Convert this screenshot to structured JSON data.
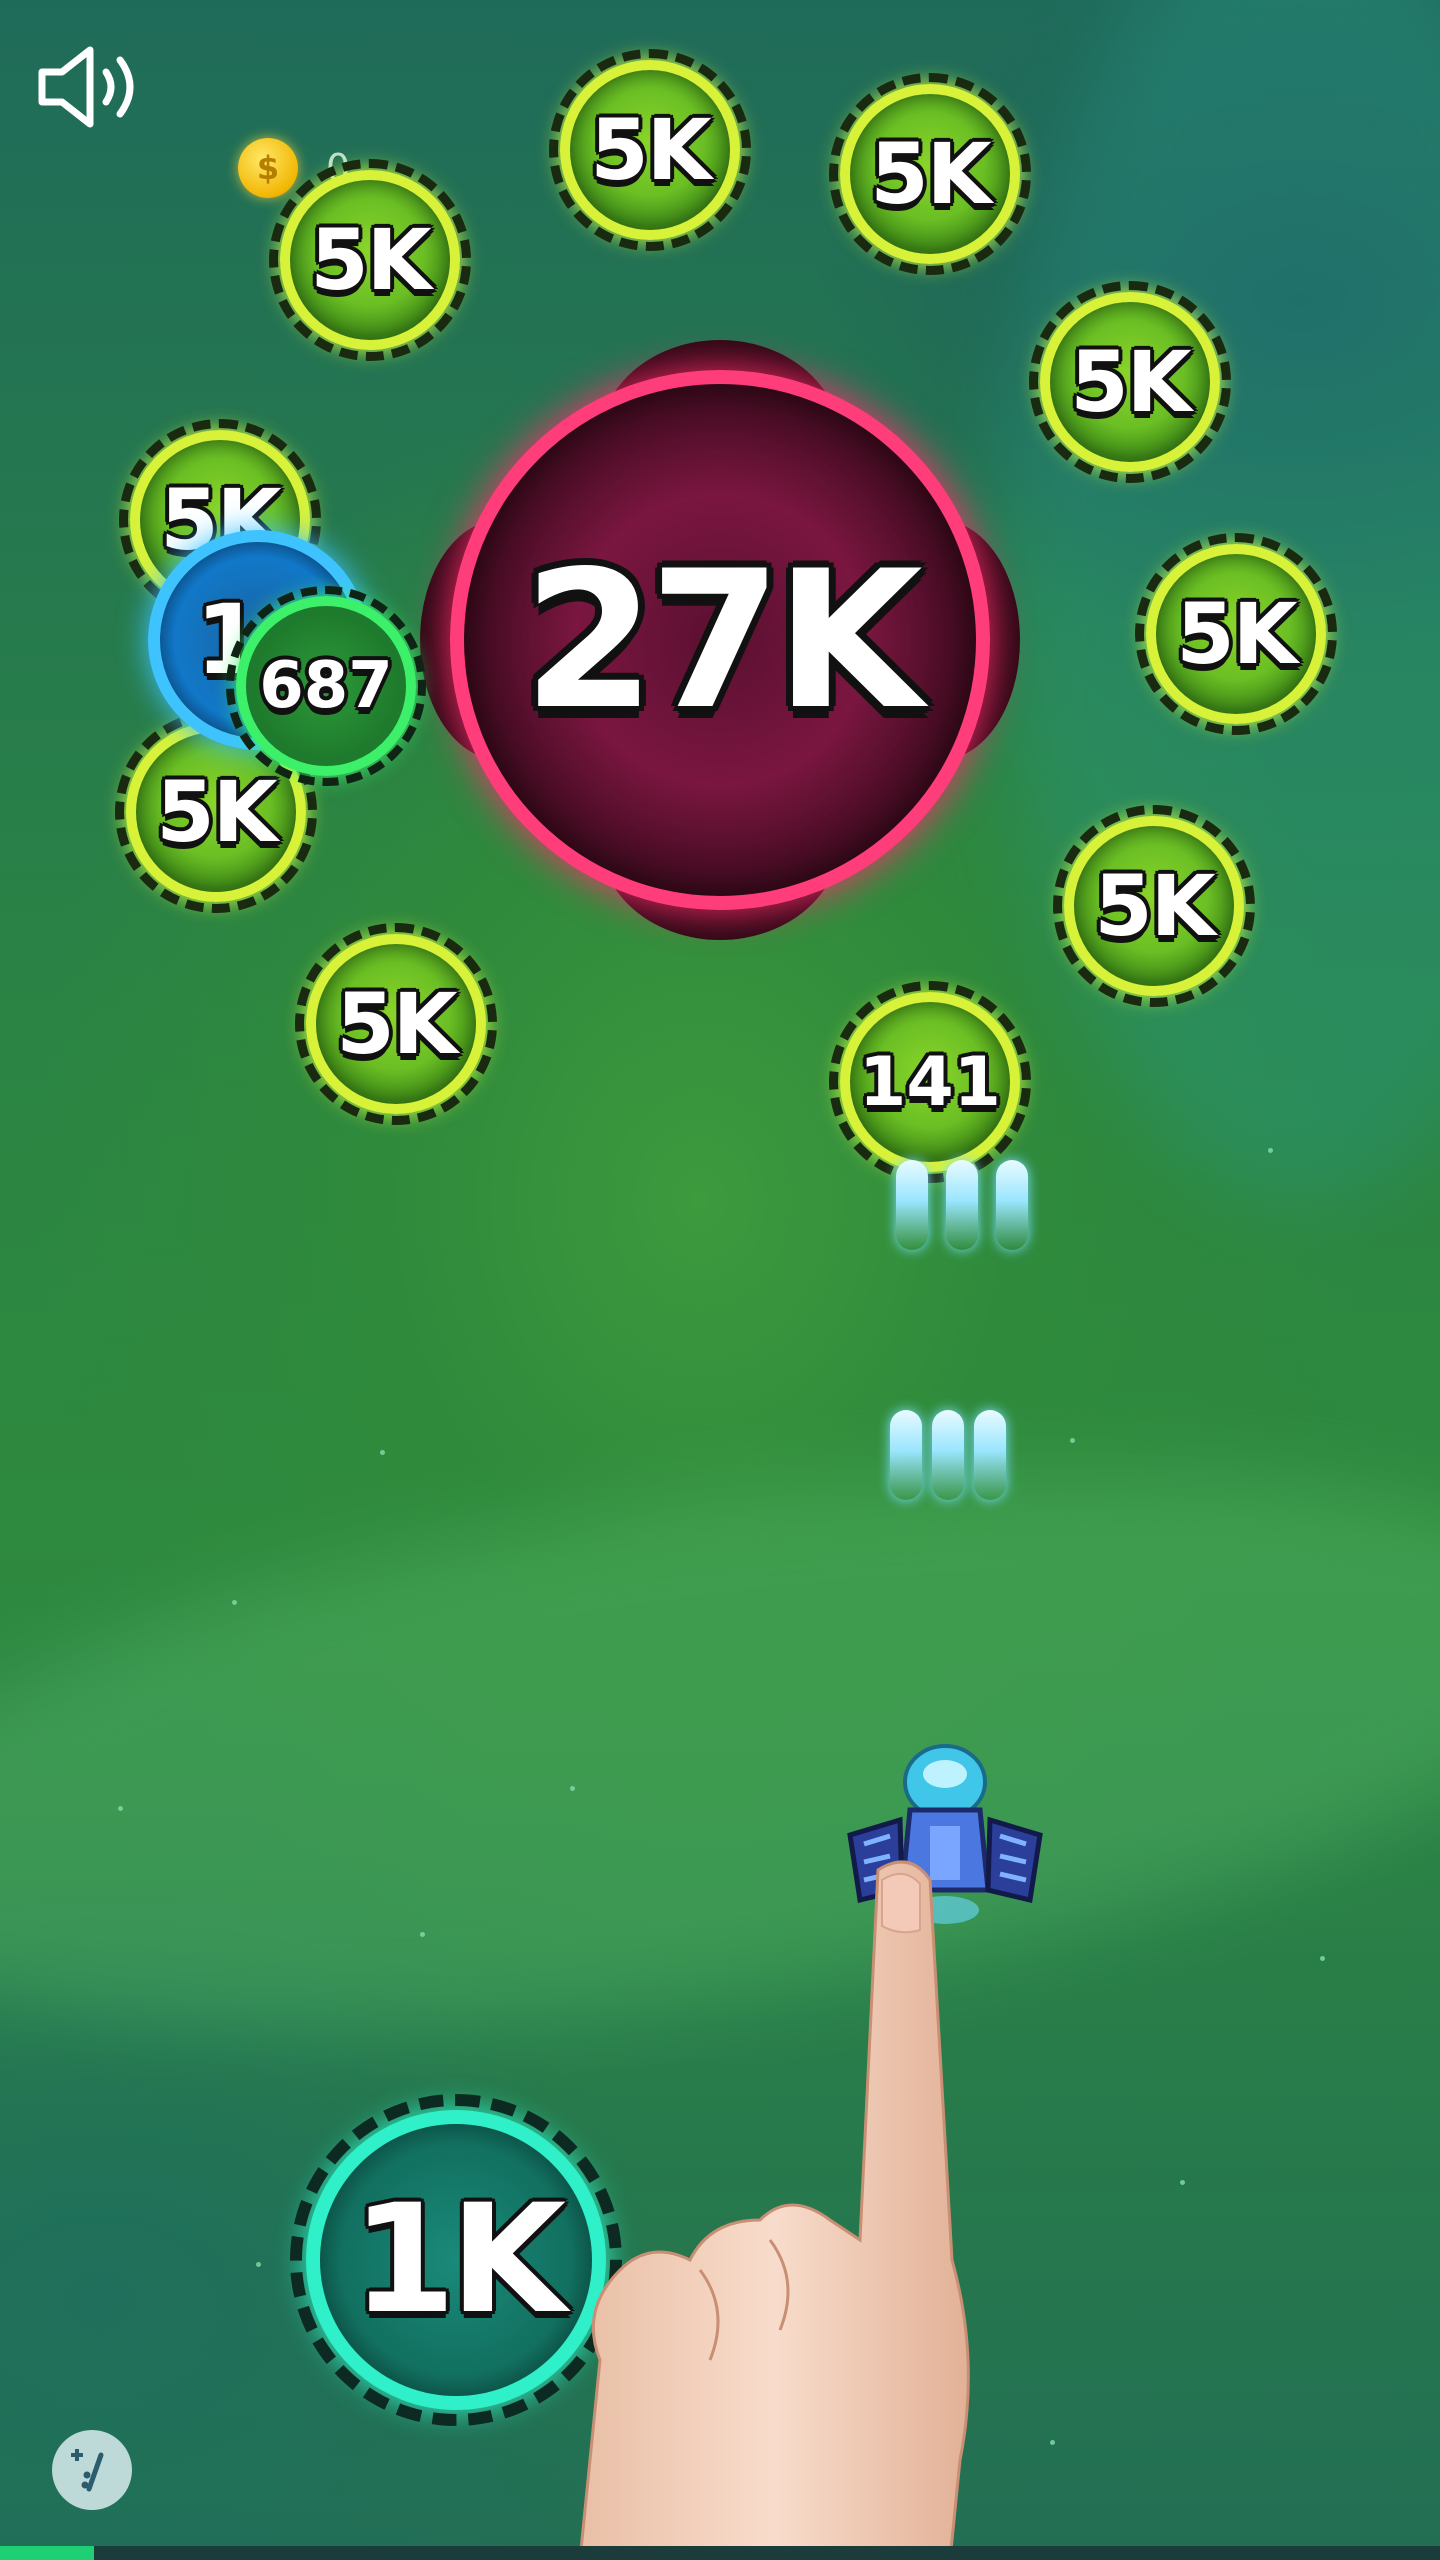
{
  "hud": {
    "sound_icon": "speaker-volume-icon",
    "coin_icon": "coin-icon",
    "coin_count": "0",
    "hint_icon": "plus-slash-icon"
  },
  "boss": {
    "label": "27K"
  },
  "bubbles": {
    "top_left": "5K",
    "top_center": "5K",
    "top_right": "5K",
    "right_upper": "5K",
    "left_upper": "5K",
    "right_middle": "5K",
    "left_lower": "5K",
    "right_lower": "5K",
    "left_bottom": "5K",
    "hit_small": "141",
    "blue_partial": "1",
    "green_small": "687",
    "teal_bottom": "1K"
  },
  "player": {
    "ship_icon": "spaceship-icon",
    "hand_icon": "pointing-finger-icon"
  },
  "progress": {
    "value": 0.065
  },
  "colors": {
    "accent_yellow": "#d8f23a",
    "boss_ring": "#ff3d7a",
    "teal_ring": "#2ff0c8",
    "progress": "#1fcf74"
  }
}
